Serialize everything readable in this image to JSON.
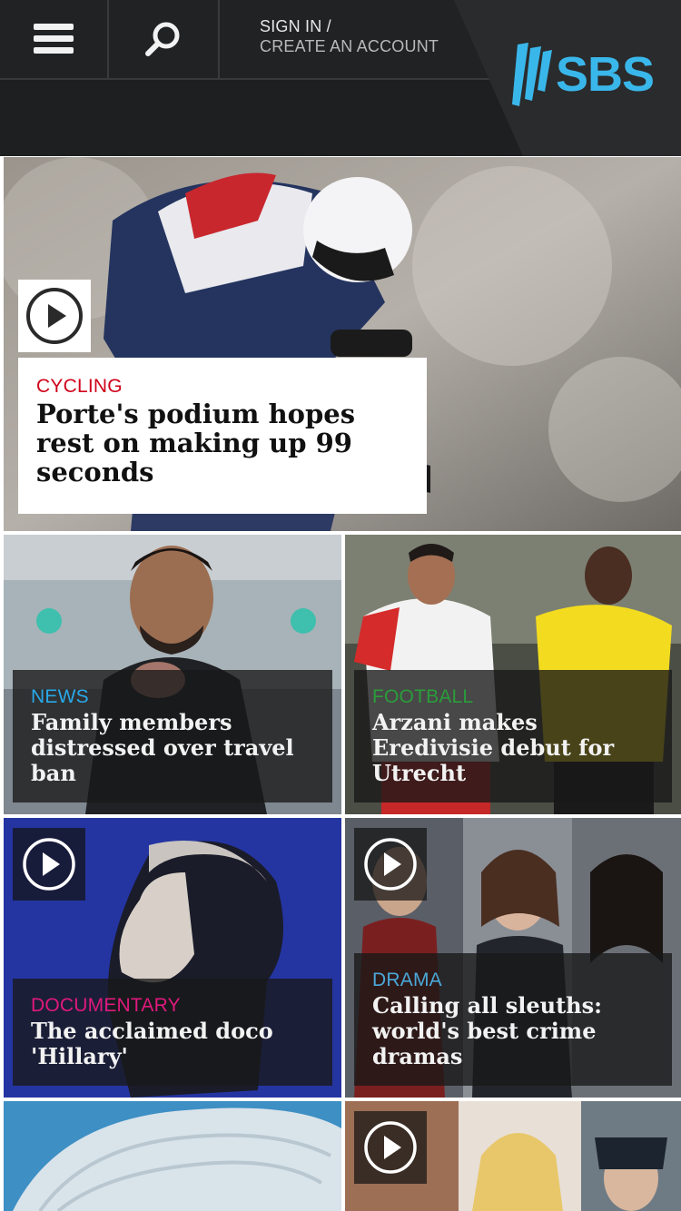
{
  "header": {
    "signin_line1": "SIGN IN /",
    "signin_line2": "CREATE AN ACCOUNT",
    "logo_text": "SBS",
    "logo_color": "#3ab7ea"
  },
  "hero": {
    "category": "CYCLING",
    "category_color": "#d0021b",
    "title": "Porte's podium hopes rest on making up 99 seconds"
  },
  "tiles": [
    {
      "category": "NEWS",
      "category_color": "#29a9e8",
      "title": "Family members distressed over travel ban"
    },
    {
      "category": "FOOTBALL",
      "category_color": "#2a9d3a",
      "title": "Arzani makes Eredivisie debut for Utrecht"
    },
    {
      "category": "DOCUMENTARY",
      "category_color": "#e0197d",
      "title": "The acclaimed doco 'Hillary'"
    },
    {
      "category": "DRAMA",
      "category_color": "#4aa8d8",
      "title": "Calling all sleuths: world's best crime dramas"
    }
  ],
  "icons": {
    "menu": "menu-icon",
    "search": "search-icon",
    "play": "play-icon"
  }
}
